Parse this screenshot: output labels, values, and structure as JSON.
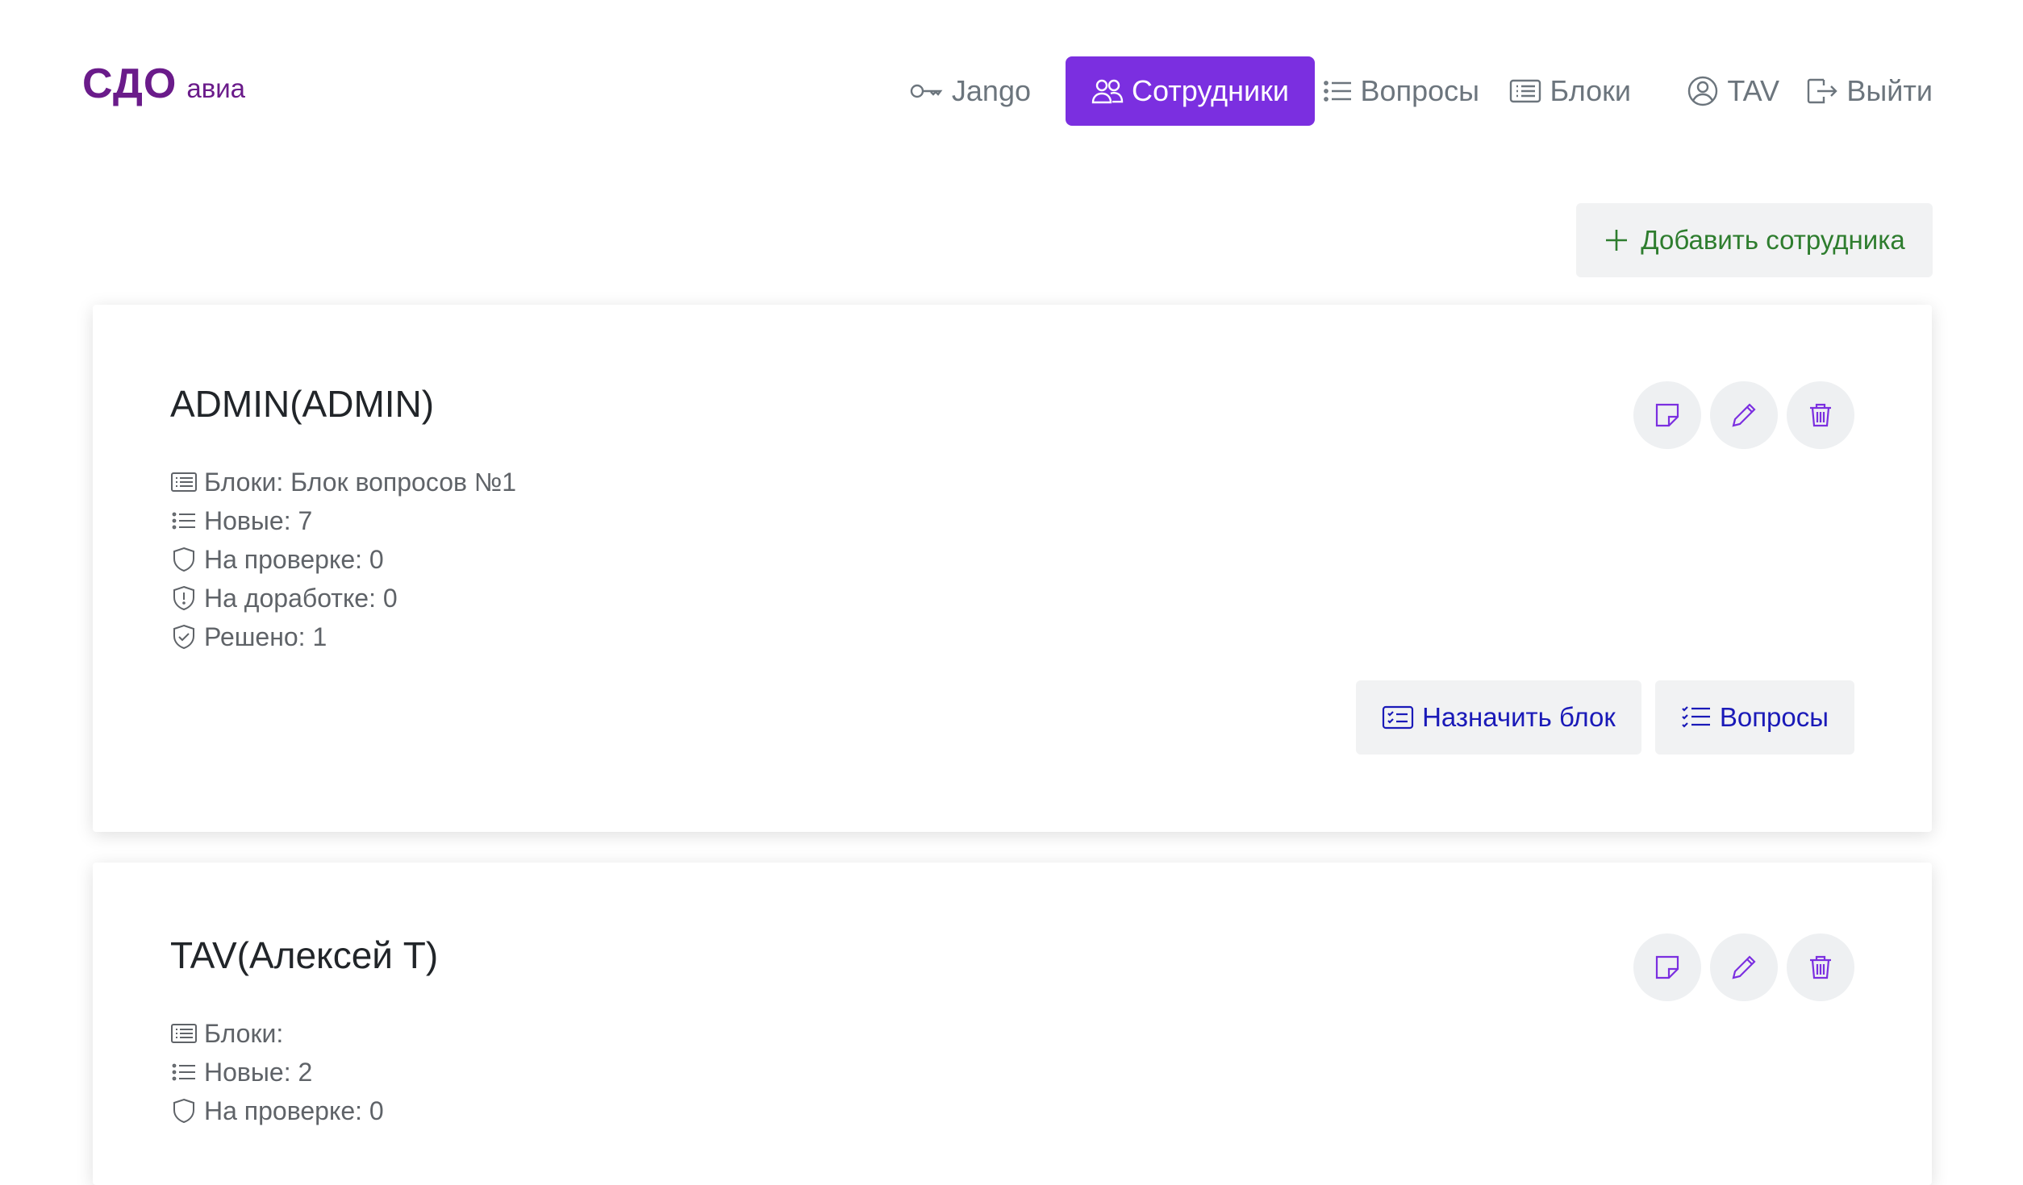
{
  "brand": {
    "main": "СДО",
    "sub": "авиа"
  },
  "nav": {
    "items": [
      {
        "label": "Jango",
        "icon": "key-icon"
      },
      {
        "label": "Сотрудники",
        "icon": "people-icon",
        "active": true
      },
      {
        "label": "Вопросы",
        "icon": "list-icon"
      },
      {
        "label": "Блоки",
        "icon": "card-list-icon"
      },
      {
        "label": "TAV",
        "icon": "user-circle-icon"
      },
      {
        "label": "Выйти",
        "icon": "logout-icon"
      }
    ]
  },
  "add_button": {
    "label": "Добавить сотрудника"
  },
  "employees": [
    {
      "title": "ADMIN(ADMIN)",
      "stats": {
        "blocks": "Блоки: Блок вопросов №1",
        "new": "Новые: 7",
        "review": "На проверке: 0",
        "rework": "На доработке: 0",
        "solved": "Решено: 1"
      },
      "actions": {
        "assign": "Назначить блок",
        "questions": "Вопросы"
      }
    },
    {
      "title": "TAV(Алексей Т)",
      "stats": {
        "blocks": "Блоки:",
        "new": "Новые: 2",
        "review": "На проверке: 0"
      }
    }
  ],
  "colors": {
    "brand": "#6a1b8a",
    "accent": "#7b2fe0",
    "add_green": "#2e7d2e",
    "link_blue": "#1a1ab8"
  }
}
